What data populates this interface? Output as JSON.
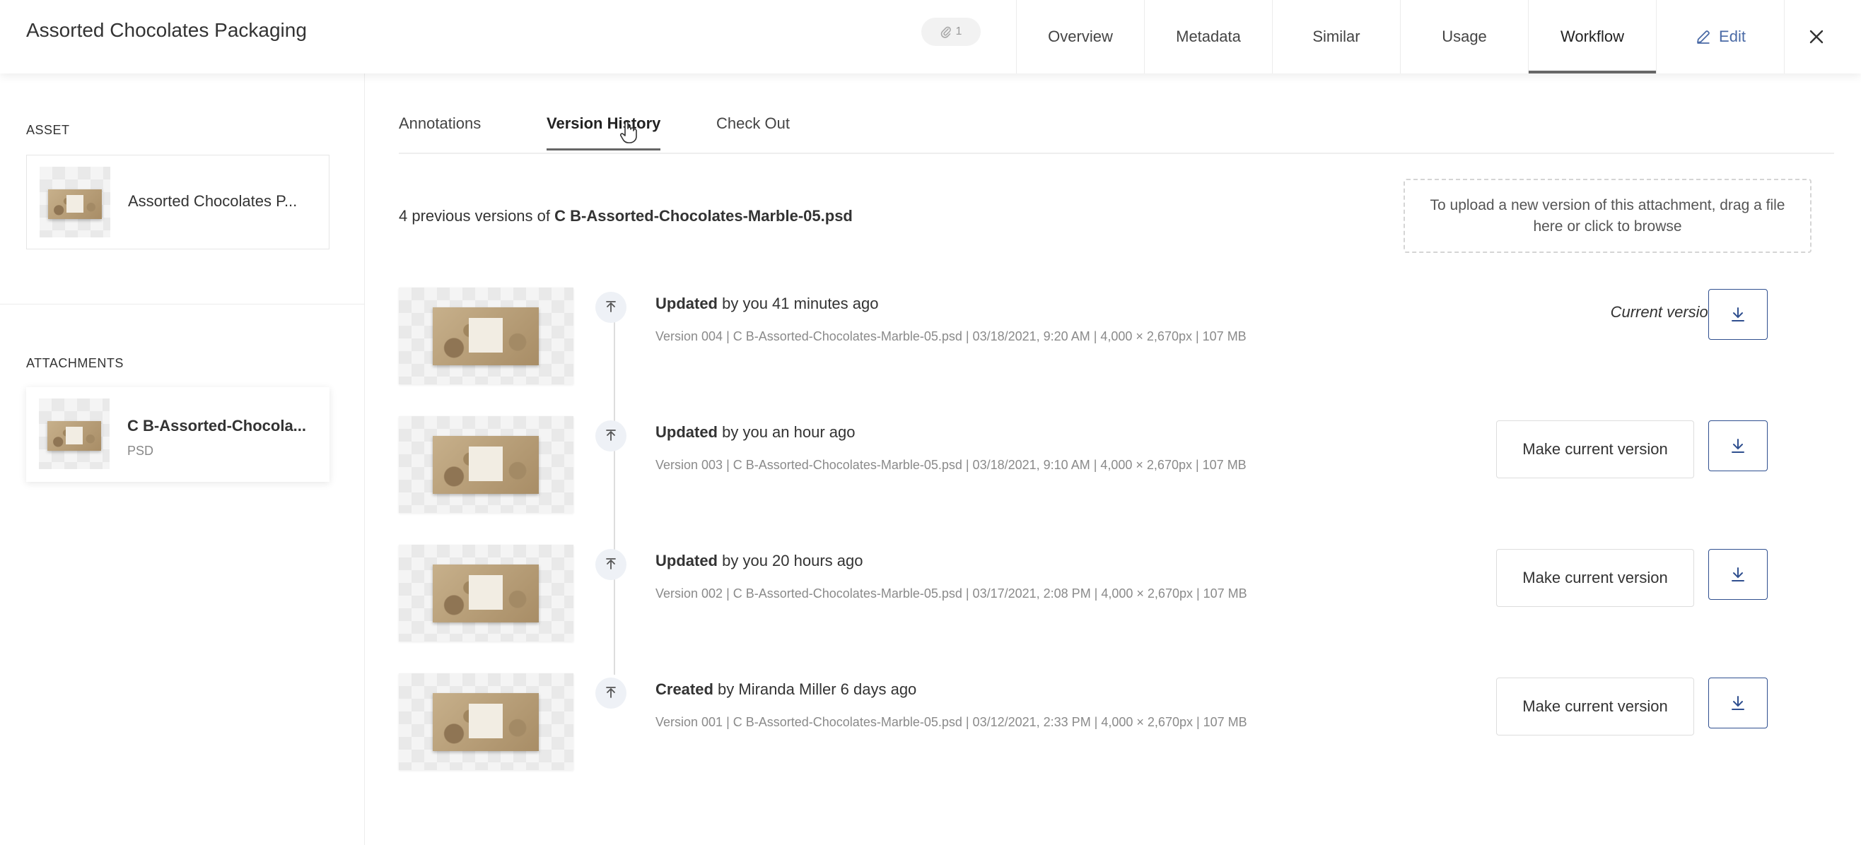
{
  "header": {
    "title": "Assorted Chocolates Packaging",
    "attachment_count": "1",
    "tabs": [
      {
        "label": "Overview"
      },
      {
        "label": "Metadata"
      },
      {
        "label": "Similar"
      },
      {
        "label": "Usage"
      },
      {
        "label": "Workflow",
        "active": true
      }
    ],
    "edit_label": "Edit"
  },
  "sidebar": {
    "asset_label": "ASSET",
    "asset_name": "Assorted Chocolates P...",
    "attachments_label": "ATTACHMENTS",
    "attachment": {
      "name": "C B-Assorted-Chocola...",
      "type": "PSD"
    }
  },
  "main": {
    "sub_tabs": [
      {
        "label": "Annotations"
      },
      {
        "label": "Version History",
        "active": true
      },
      {
        "label": "Check Out"
      }
    ],
    "previous_versions_prefix": "4 previous versions of",
    "previous_versions_file": "C B-Assorted-Chocolates-Marble-05.psd",
    "upload_hint": "To upload a new version of this attachment, drag a file here or click to browse",
    "current_version_label": "Current version",
    "make_current_label": "Make current version",
    "versions": [
      {
        "action": "Updated",
        "by": "by you 41 minutes ago",
        "meta": "Version 004   |   C B-Assorted-Chocolates-Marble-05.psd   |   03/18/2021, 9:20 AM   |   4,000 × 2,670px   |   107 MB",
        "current": true
      },
      {
        "action": "Updated",
        "by": "by you an hour ago",
        "meta": "Version 003   |   C B-Assorted-Chocolates-Marble-05.psd   |   03/18/2021, 9:10 AM   |   4,000 × 2,670px   |   107 MB",
        "current": false
      },
      {
        "action": "Updated",
        "by": "by you 20 hours ago",
        "meta": "Version 002   |   C B-Assorted-Chocolates-Marble-05.psd   |   03/17/2021, 2:08 PM   |   4,000 × 2,670px   |   107 MB",
        "current": false
      },
      {
        "action": "Created",
        "by": "by Miranda Miller 6 days ago",
        "meta": "Version 001   |   C B-Assorted-Chocolates-Marble-05.psd   |   03/12/2021, 2:33 PM   |   4,000 × 2,670px   |   107 MB",
        "current": false
      }
    ]
  },
  "colors": {
    "accent": "#2f4f8f",
    "edit_link": "#4a6aa6",
    "muted_text": "#8a8a8a"
  },
  "icons": [
    "paperclip-icon",
    "pencil-icon",
    "close-icon",
    "upload-arrow-icon",
    "download-icon",
    "hand-cursor-icon"
  ]
}
